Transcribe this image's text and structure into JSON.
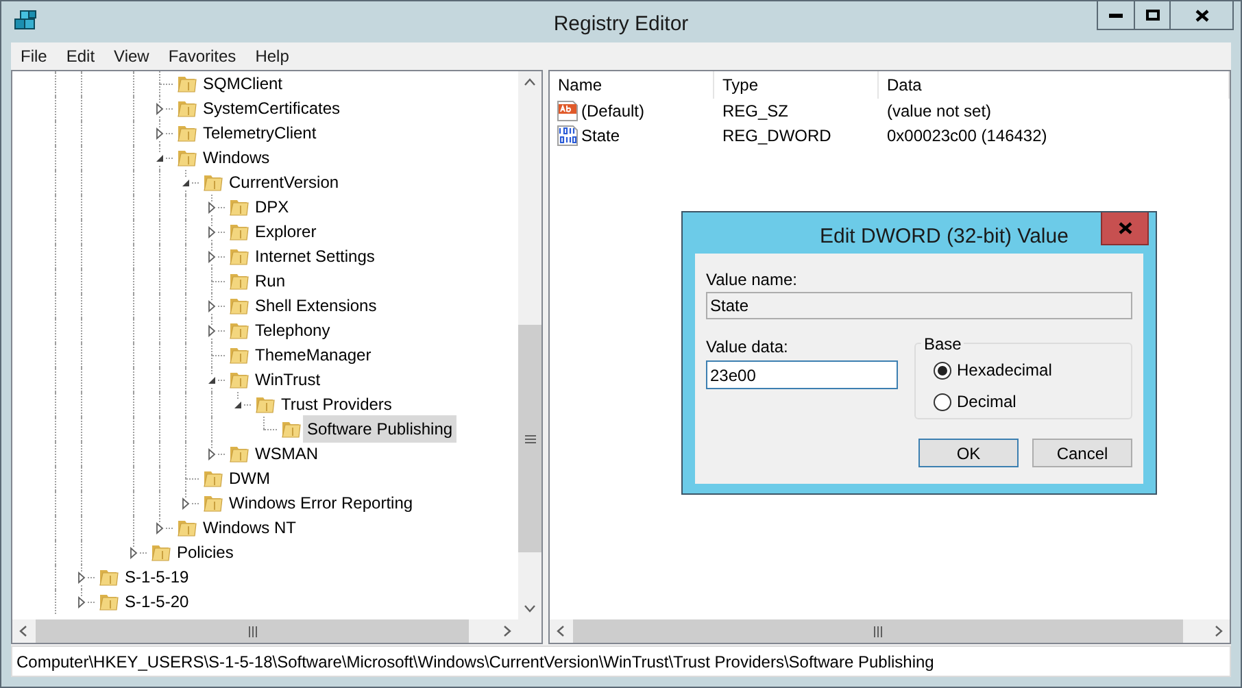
{
  "window": {
    "title": "Registry Editor"
  },
  "menu": [
    "File",
    "Edit",
    "View",
    "Favorites",
    "Help"
  ],
  "tree": [
    {
      "children": [
        {
          "children": [
            {
              "children": [
                {
                  "label": "SQMClient",
                  "selected": false
                },
                {
                  "label": "SystemCertificates",
                  "expanded": false,
                  "selected": false
                },
                {
                  "label": "TelemetryClient",
                  "expanded": false,
                  "selected": false
                },
                {
                  "label": "Windows",
                  "expanded": true,
                  "selected": false,
                  "children": [
                    {
                      "label": "CurrentVersion",
                      "expanded": true,
                      "selected": false,
                      "children": [
                        {
                          "label": "DPX",
                          "expanded": false,
                          "selected": false
                        },
                        {
                          "label": "Explorer",
                          "expanded": false,
                          "selected": false
                        },
                        {
                          "label": "Internet Settings",
                          "expanded": false,
                          "selected": false
                        },
                        {
                          "label": "Run",
                          "selected": false
                        },
                        {
                          "label": "Shell Extensions",
                          "expanded": false,
                          "selected": false
                        },
                        {
                          "label": "Telephony",
                          "expanded": false,
                          "selected": false
                        },
                        {
                          "label": "ThemeManager",
                          "selected": false
                        },
                        {
                          "label": "WinTrust",
                          "expanded": true,
                          "selected": false,
                          "children": [
                            {
                              "label": "Trust Providers",
                              "expanded": true,
                              "selected": false,
                              "children": [
                                {
                                  "label": "Software Publishing",
                                  "selected": true
                                }
                              ]
                            }
                          ]
                        },
                        {
                          "label": "WSMAN",
                          "expanded": false,
                          "selected": false
                        }
                      ]
                    },
                    {
                      "label": "DWM",
                      "selected": false
                    },
                    {
                      "label": "Windows Error Reporting",
                      "expanded": false,
                      "selected": false
                    }
                  ]
                },
                {
                  "label": "Windows NT",
                  "expanded": false,
                  "selected": false
                }
              ]
            },
            {
              "label": "Policies",
              "expanded": false,
              "selected": false
            }
          ]
        }
      ]
    },
    {
      "label": "S-1-5-19",
      "expanded": false,
      "selected": false
    },
    {
      "label": "S-1-5-20",
      "expanded": false,
      "selected": false
    }
  ],
  "values": {
    "columns": [
      "Name",
      "Type",
      "Data"
    ],
    "rows": [
      {
        "kind": "string",
        "name": "(Default)",
        "type": "REG_SZ",
        "data": "(value not set)"
      },
      {
        "kind": "dword",
        "name": "State",
        "type": "REG_DWORD",
        "data": "0x00023c00 (146432)"
      }
    ]
  },
  "dialog": {
    "title": "Edit DWORD (32-bit) Value",
    "value_name_label": "Value name:",
    "value_name": "State",
    "value_data_label": "Value data:",
    "value_data": "23e00",
    "base": {
      "label": "Base",
      "options": [
        {
          "label": "Hexadecimal",
          "selected": true
        },
        {
          "label": "Decimal",
          "selected": false
        }
      ]
    },
    "buttons": [
      {
        "label": "OK",
        "default": true
      },
      {
        "label": "Cancel",
        "default": false
      }
    ]
  },
  "status_bar": "Computer\\HKEY_USERS\\S-1-5-18\\Software\\Microsoft\\Windows\\CurrentVersion\\WinTrust\\Trust Providers\\Software Publishing"
}
